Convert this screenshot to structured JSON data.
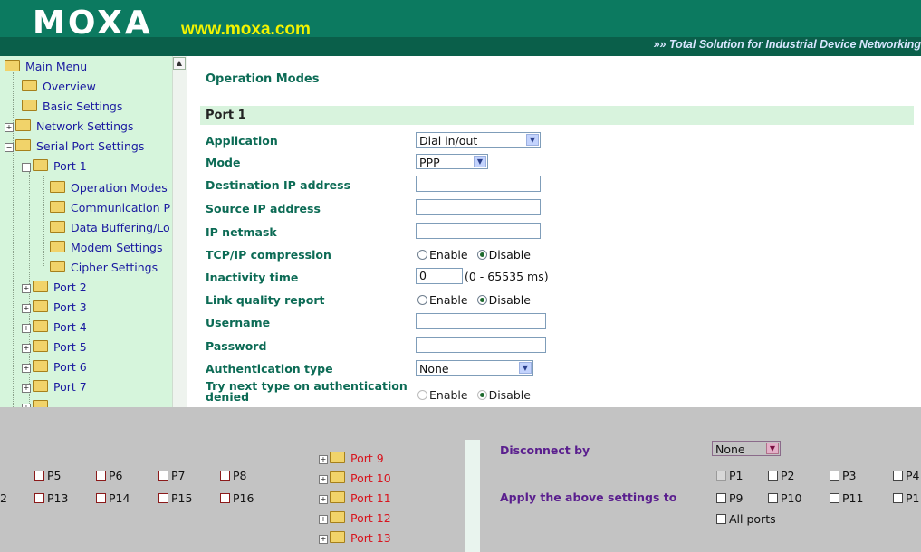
{
  "header": {
    "logo": "MOXA",
    "url": "www.moxa.com",
    "tagline": "»» Total Solution for Industrial Device Networking"
  },
  "sidebar": {
    "main_menu": "Main Menu",
    "overview": "Overview",
    "basic_settings": "Basic Settings",
    "network_settings": "Network Settings",
    "serial_port_settings": "Serial Port Settings",
    "port1": "Port 1",
    "operation_modes": "Operation Modes",
    "communication": "Communication P",
    "data_buffering": "Data Buffering/Lo",
    "modem_settings": "Modem Settings",
    "cipher_settings": "Cipher Settings",
    "port2": "Port 2",
    "port3": "Port 3",
    "port4": "Port 4",
    "port5": "Port 5",
    "port6": "Port 6",
    "port7": "Port 7"
  },
  "main": {
    "page_title": "Operation Modes",
    "section_title": "Port 1",
    "labels": {
      "application": "Application",
      "mode": "Mode",
      "dest_ip": "Destination IP address",
      "source_ip": "Source IP address",
      "netmask": "IP netmask",
      "tcp_compression": "TCP/IP compression",
      "inactivity": "Inactivity time",
      "link_quality": "Link quality report",
      "username": "Username",
      "password": "Password",
      "auth_type": "Authentication type",
      "try_next_line1": "Try next type on authentication",
      "try_next_line2": "denied"
    },
    "values": {
      "application": "Dial in/out",
      "mode": "PPP",
      "dest_ip": "",
      "source_ip": "",
      "netmask": "",
      "inactivity": "0",
      "inactivity_hint": "(0 - 65535 ms)",
      "username": "",
      "password": "",
      "auth_type": "None"
    },
    "radio": {
      "enable": "Enable",
      "disable": "Disable"
    }
  },
  "bottom": {
    "left_ports_row1": [
      "P5",
      "P6",
      "P7",
      "P8"
    ],
    "left_ports_row2": [
      "P13",
      "P14",
      "P15",
      "P16"
    ],
    "left_fragment": "2",
    "tree_ports": [
      "Port 9",
      "Port 10",
      "Port 11",
      "Port 12",
      "Port 13"
    ],
    "disconnect_by_label": "Disconnect by",
    "disconnect_by_value": "None",
    "apply_label": "Apply the above settings to",
    "apply_row1": [
      "P1",
      "P2",
      "P3",
      "P4"
    ],
    "apply_row2": [
      "P9",
      "P10",
      "P11",
      "P1"
    ],
    "all_ports": "All ports"
  },
  "colors": {
    "header": "#0c7a60",
    "sidebar": "#d6f5dc",
    "label": "#0c6b55",
    "bottom": "#c3c3c3"
  }
}
